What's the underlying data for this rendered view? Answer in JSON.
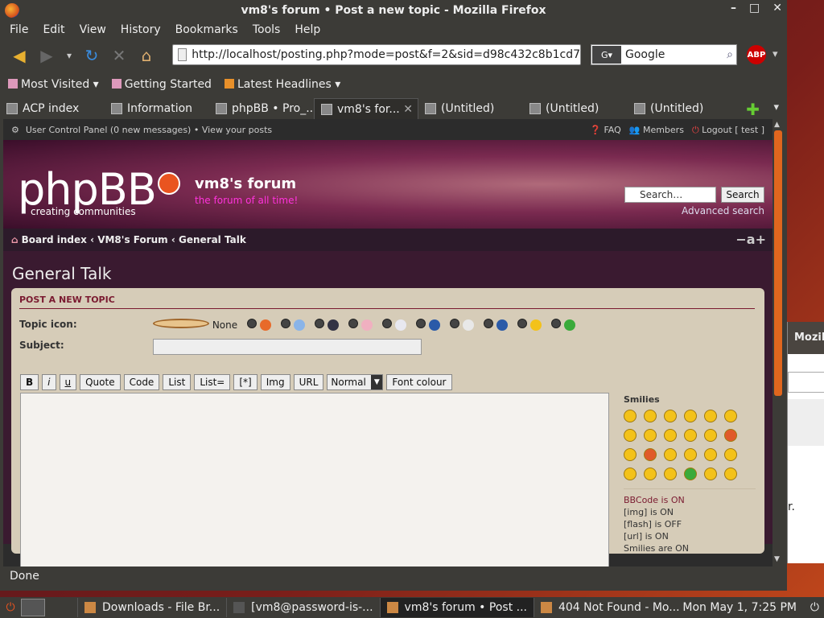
{
  "window": {
    "title": "vm8's forum • Post a new topic - Mozilla Firefox",
    "controls": [
      "–",
      "□",
      "✕"
    ]
  },
  "menu": [
    "File",
    "Edit",
    "View",
    "History",
    "Bookmarks",
    "Tools",
    "Help"
  ],
  "nav": {
    "url": "http://localhost/posting.php?mode=post&f=2&sid=d98c432c8b1cd7",
    "search_engine_text": "Google"
  },
  "bookmarks": [
    "Most Visited",
    "Getting Started",
    "Latest Headlines"
  ],
  "tabs": [
    "ACP index",
    "Information",
    "phpBB • Pro_...",
    "vm8's for...",
    "(Untitled)",
    "(Untitled)",
    "(Untitled)"
  ],
  "forum": {
    "topnav_left": "User Control Panel (0 new messages) • View your posts",
    "faq": "FAQ",
    "members": "Members",
    "logout": "Logout [ test ]",
    "logo": "phpBB",
    "logo_sub": "creating   communities",
    "site_title": "vm8's forum",
    "site_desc": "the forum of all time!",
    "search_placeholder": "Search…",
    "search_button": "Search",
    "advanced_search": "Advanced search",
    "breadcrumb": "Board index ‹ VM8's Forum ‹ General Talk",
    "font_resize": "−a+",
    "page_title": "General Talk",
    "panel_head": "POST A NEW TOPIC",
    "topic_icon_label": "Topic icon:",
    "topic_icon_none": "None",
    "subject_label": "Subject:",
    "toolbar": [
      "B",
      "i",
      "u",
      "Quote",
      "Code",
      "List",
      "List=",
      "[*]",
      "Img",
      "URL"
    ],
    "font_size_select": "Normal",
    "font_colour": "Font colour",
    "smilies_title": "Smilies",
    "bbcode_status": {
      "bbcode": "BBCode is ON",
      "img": "[img] is ON",
      "flash": "[flash] is OFF",
      "url": "[url] is ON",
      "smilies": "Smilies are ON"
    }
  },
  "status": "Done",
  "taskbar": {
    "items": [
      "Downloads - File Br...",
      "[vm8@password-is-...",
      "vm8's forum • Post ...",
      "404 Not Found - Mo..."
    ],
    "clock": "Mon May  1,  7:25 PM"
  },
  "background_window": {
    "title": "Mozil",
    "text": "r."
  },
  "colors": {
    "accent": "#e95420",
    "panel": "#d6ccb8",
    "chrome": "#3c3b37"
  }
}
